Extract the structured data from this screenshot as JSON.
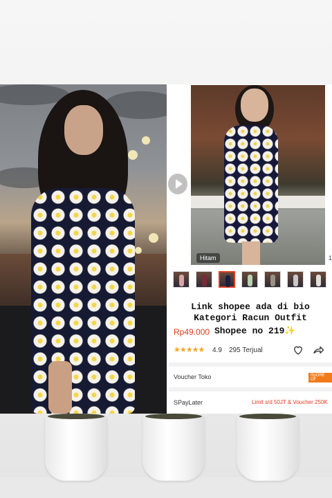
{
  "product": {
    "variant_label": "Hitam",
    "page_count": "1",
    "caption_lines": [
      "Link shopee ada di bio",
      "Kategori Racun Outfit"
    ],
    "price": "Rp49.000",
    "caption_line3": "Shopee no 219",
    "sparkle": "✨",
    "rating": "4.9",
    "sold": "295 Terjual",
    "stars": "★★★★★",
    "voucher_label": "Voucher Toko",
    "voucher_badge": "RpORE OF",
    "paylater_label": "SPayLater",
    "paylater_promo": "Limit s/d 50JT & Voucher 250K"
  },
  "colors": {
    "accent": "#e5391d",
    "star": "#f5a623",
    "voucher_badge": "#f27a1a"
  },
  "icons": [
    "play-icon",
    "heart-icon",
    "share-icon",
    "star-icon"
  ]
}
